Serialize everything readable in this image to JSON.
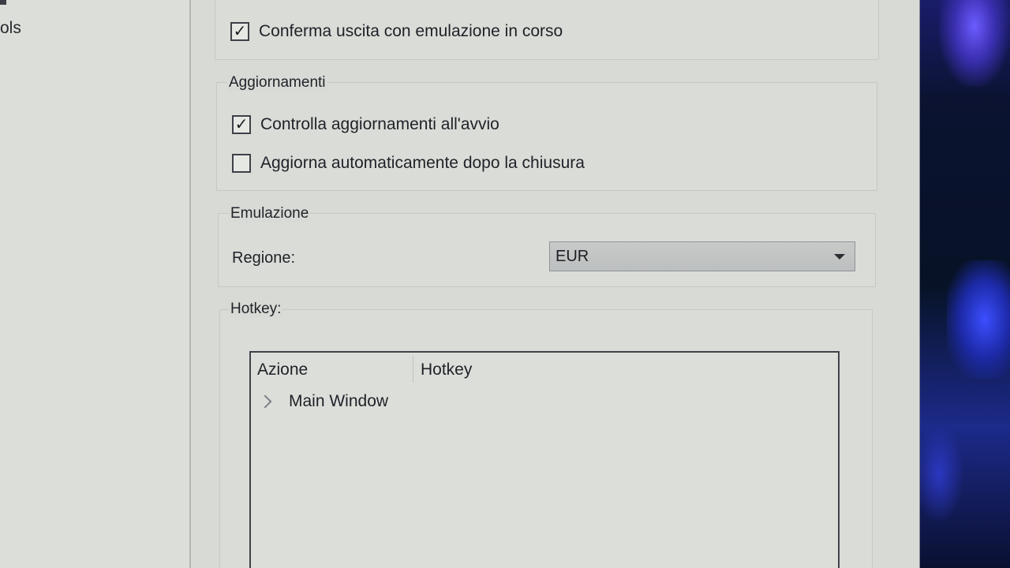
{
  "nav": {
    "fragment_text": "ols"
  },
  "general": {
    "confirm_exit_label": "Conferma uscita con emulazione in corso",
    "confirm_exit_checked": true
  },
  "updates": {
    "title": "Aggiornamenti",
    "check_on_start_label": "Controlla aggiornamenti all'avvio",
    "check_on_start_checked": true,
    "auto_update_label": "Aggiorna automaticamente dopo la chiusura",
    "auto_update_checked": false
  },
  "emulation": {
    "title": "Emulazione",
    "region_label": "Regione:",
    "region_value": "EUR"
  },
  "hotkeys": {
    "title": "Hotkey:",
    "columns": [
      "Azione",
      "Hotkey"
    ],
    "rows": [
      {
        "action": "Main Window",
        "hotkey": ""
      }
    ]
  }
}
